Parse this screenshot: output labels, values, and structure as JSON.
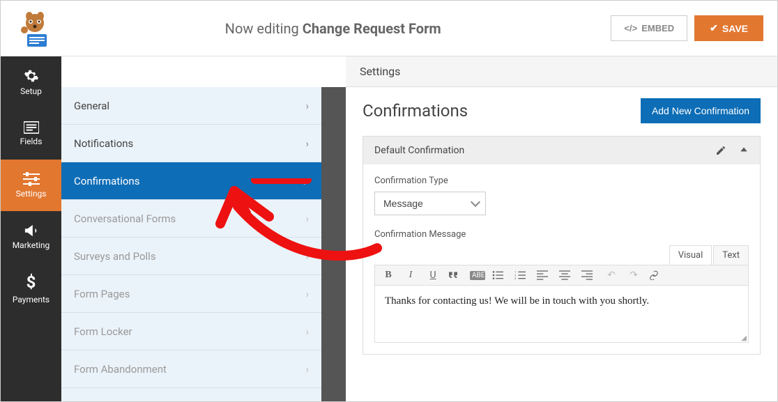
{
  "header": {
    "prefix": "Now editing ",
    "title": "Change Request Form",
    "embed": "EMBED",
    "save": "SAVE"
  },
  "leftnav": {
    "setup": "Setup",
    "fields": "Fields",
    "settings": "Settings",
    "marketing": "Marketing",
    "payments": "Payments"
  },
  "settings_bar": "Settings",
  "subsidebar": {
    "items": [
      {
        "label": "General"
      },
      {
        "label": "Notifications"
      },
      {
        "label": "Confirmations"
      },
      {
        "label": "Conversational Forms"
      },
      {
        "label": "Surveys and Polls"
      },
      {
        "label": "Form Pages"
      },
      {
        "label": "Form Locker"
      },
      {
        "label": "Form Abandonment"
      }
    ]
  },
  "right": {
    "title": "Confirmations",
    "add_btn": "Add New Confirmation",
    "default_conf": "Default Confirmation",
    "conf_type_label": "Confirmation Type",
    "conf_type_value": "Message",
    "conf_msg_label": "Confirmation Message",
    "visual_tab": "Visual",
    "text_tab": "Text",
    "message_text": "Thanks for contacting us! We will be in touch with you shortly."
  }
}
